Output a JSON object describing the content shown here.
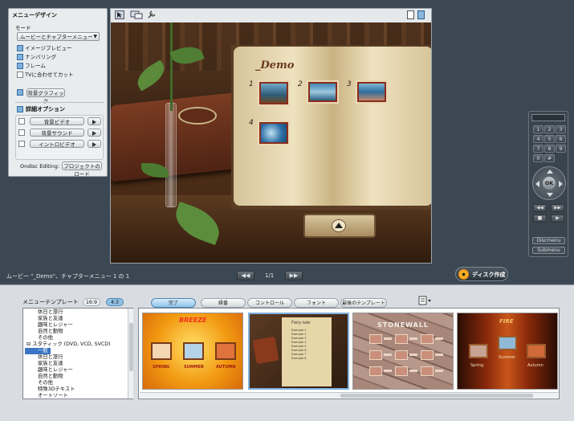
{
  "left_panel": {
    "title": "メニューデザイン",
    "mode_label": "モード",
    "mode_value": "ムービーとチャプターメニュー",
    "options": [
      {
        "label": "イメージプレビュー",
        "checked": true
      },
      {
        "label": "ナンバリング",
        "checked": true
      },
      {
        "label": "フレーム",
        "checked": true
      },
      {
        "label": "TVに合わせてカット",
        "checked": false
      }
    ],
    "bg_graphic_label": "背景グラフィック",
    "detail_title": "詳細オプション",
    "bg_video_label": "背景ビデオ",
    "bg_sound_label": "背景サウンド",
    "intro_video_label": "イントロビデオ",
    "ondisc_label": "Ondisc Editing:",
    "project_load_label": "プロジェクトのロード"
  },
  "preview": {
    "demo_title": "_Demo",
    "chapters": [
      "1",
      "2",
      "3",
      "4"
    ]
  },
  "status": {
    "text": "ムービー \"_Demo\"、チャプターメニュー 1 の 1",
    "page": "1/1"
  },
  "disc_button": "ディスク作成",
  "remote": {
    "keys": [
      "1",
      "2",
      "3",
      "4",
      "5",
      "6",
      "7",
      "8",
      "9",
      "0",
      "#"
    ],
    "ok": "OK",
    "discmenu": "Discmenu",
    "submenu": "Submenu"
  },
  "template": {
    "title": "メニューテンプレート",
    "ratio_169": "16:9",
    "ratio_43": "4:3",
    "tabs": [
      "完了",
      "縁番",
      "コントロール",
      "フォント",
      "最後のテンプレート"
    ],
    "tree": [
      {
        "label": "休日と旅行",
        "indent": 1
      },
      {
        "label": "家族と友達",
        "indent": 1
      },
      {
        "label": "趣味とレジャー",
        "indent": 1
      },
      {
        "label": "自然と動物",
        "indent": 1
      },
      {
        "label": "その他",
        "indent": 1
      },
      {
        "label": "スタティック (DVD, VCD, SVCD)",
        "indent": 0,
        "expander": "⊟"
      },
      {
        "label": "一般",
        "indent": 1,
        "selected": true
      },
      {
        "label": "休日と旅行",
        "indent": 1
      },
      {
        "label": "家族と友達",
        "indent": 1
      },
      {
        "label": "趣味とレジャー",
        "indent": 1
      },
      {
        "label": "自然と動物",
        "indent": 1
      },
      {
        "label": "その他",
        "indent": 1
      },
      {
        "label": "特殊3Dテキスト",
        "indent": 1
      },
      {
        "label": "オートソート",
        "indent": 1
      }
    ],
    "thumbs": [
      {
        "title": "BREEZE",
        "labels": [
          "SPRING",
          "SUMMER",
          "AUTUMN"
        ]
      },
      {
        "title": "Fairy tale",
        "labels": [
          "Example 1",
          "Example 2",
          "Example 3",
          "Example 4",
          "Example 5",
          "Example 6",
          "Example 7",
          "Example 8"
        ]
      },
      {
        "title": "STONEWALL",
        "labels": []
      },
      {
        "title": "FIRE",
        "labels": [
          "Spring",
          "Summer",
          "Autumn"
        ]
      }
    ]
  }
}
